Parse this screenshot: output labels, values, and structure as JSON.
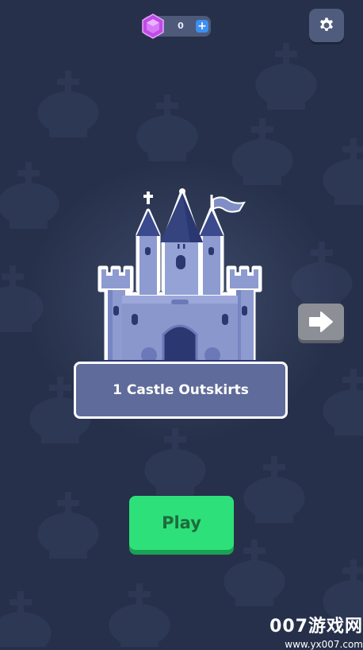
{
  "currency": {
    "gems": "0",
    "add_label": "+"
  },
  "level": {
    "title": "1 Castle Outskirts"
  },
  "actions": {
    "play_label": "Play"
  },
  "watermark": {
    "brand": "007游戏网",
    "url": "www.yx007.com"
  },
  "icons": {
    "gem": "gem-icon",
    "settings": "gear-icon",
    "next": "arrow-right-icon",
    "castle": "castle-illustration",
    "background": "chess-king-pattern"
  },
  "colors": {
    "background": "#26304a",
    "pattern": "#34405e",
    "card": "#5f6b9a",
    "play": "#2ee07a",
    "play_text": "#1e6b3c",
    "gem": "#c04be6",
    "plus": "#3d8ff2"
  }
}
